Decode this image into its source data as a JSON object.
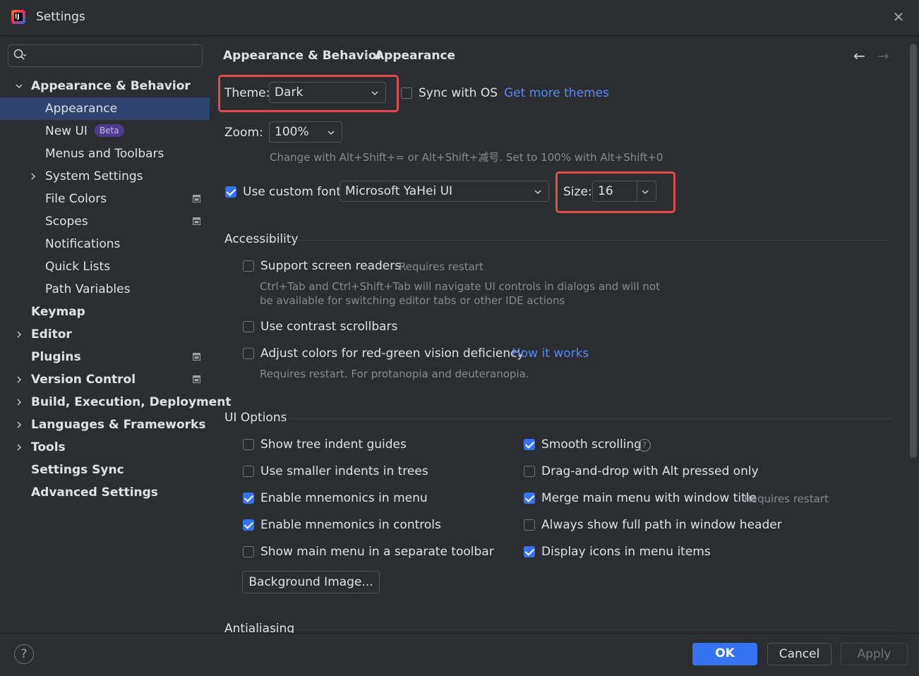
{
  "window": {
    "title": "Settings",
    "close_symbol": "✕",
    "app_icon_letters": "IJ"
  },
  "breadcrumb": {
    "parent": "Appearance & Behavior",
    "separator": "›",
    "current": "Appearance"
  },
  "nav": {
    "back_symbol": "←",
    "forward_symbol": "→"
  },
  "sidebar": {
    "search_placeholder": "",
    "items": [
      {
        "label": "Appearance & Behavior",
        "level": 0,
        "bold": true,
        "expandable": true,
        "expanded": true
      },
      {
        "label": "Appearance",
        "level": 1,
        "selected": true
      },
      {
        "label": "New UI",
        "level": 1,
        "badge": "Beta"
      },
      {
        "label": "Menus and Toolbars",
        "level": 1
      },
      {
        "label": "System Settings",
        "level": 1,
        "expandable": true,
        "expanded": false
      },
      {
        "label": "File Colors",
        "level": 1,
        "project_icon": true
      },
      {
        "label": "Scopes",
        "level": 1,
        "project_icon": true
      },
      {
        "label": "Notifications",
        "level": 1
      },
      {
        "label": "Quick Lists",
        "level": 1
      },
      {
        "label": "Path Variables",
        "level": 1
      },
      {
        "label": "Keymap",
        "level": 0,
        "bold": true
      },
      {
        "label": "Editor",
        "level": 0,
        "bold": true,
        "expandable": true,
        "expanded": false
      },
      {
        "label": "Plugins",
        "level": 0,
        "bold": true,
        "project_icon": true
      },
      {
        "label": "Version Control",
        "level": 0,
        "bold": true,
        "expandable": true,
        "expanded": false,
        "project_icon": true
      },
      {
        "label": "Build, Execution, Deployment",
        "level": 0,
        "bold": true,
        "expandable": true,
        "expanded": false
      },
      {
        "label": "Languages & Frameworks",
        "level": 0,
        "bold": true,
        "expandable": true,
        "expanded": false
      },
      {
        "label": "Tools",
        "level": 0,
        "bold": true,
        "expandable": true,
        "expanded": false
      },
      {
        "label": "Settings Sync",
        "level": 0,
        "bold": true
      },
      {
        "label": "Advanced Settings",
        "level": 0,
        "bold": true
      }
    ]
  },
  "theme": {
    "label": "Theme:",
    "value": "Dark",
    "sync_label": "Sync with OS",
    "sync_checked": false,
    "more_link": "Get more themes"
  },
  "zoom": {
    "label": "Zoom:",
    "value": "100%",
    "hint": "Change with Alt+Shift+= or Alt+Shift+减号. Set to 100% with Alt+Shift+0"
  },
  "font": {
    "use_custom_label": "Use custom font:",
    "use_custom_checked": true,
    "value": "Microsoft YaHei UI",
    "size_label": "Size:",
    "size_value": "16"
  },
  "accessibility": {
    "title": "Accessibility",
    "screen_readers_label": "Support screen readers",
    "screen_readers_checked": false,
    "screen_readers_hint": "Requires restart",
    "screen_readers_desc_1": "Ctrl+Tab and Ctrl+Shift+Tab will navigate UI controls in dialogs and will not",
    "screen_readers_desc_2": "be available for switching editor tabs or other IDE actions",
    "contrast_label": "Use contrast scrollbars",
    "contrast_checked": false,
    "red_green_label": "Adjust colors for red-green vision deficiency",
    "red_green_checked": false,
    "red_green_link": "How it works",
    "red_green_hint": "Requires restart. For protanopia and deuteranopia."
  },
  "ui_options": {
    "title": "UI Options",
    "left": [
      {
        "label": "Show tree indent guides",
        "checked": false
      },
      {
        "label": "Use smaller indents in trees",
        "checked": false
      },
      {
        "label": "Enable mnemonics in menu",
        "checked": true
      },
      {
        "label": "Enable mnemonics in controls",
        "checked": true
      },
      {
        "label": "Show main menu in a separate toolbar",
        "checked": false
      }
    ],
    "right": [
      {
        "label": "Smooth scrolling",
        "checked": true,
        "help": "?"
      },
      {
        "label": "Drag-and-drop with Alt pressed only",
        "checked": false
      },
      {
        "label": "Merge main menu with window title",
        "checked": true,
        "hint": "Requires restart"
      },
      {
        "label": "Always show full path in window header",
        "checked": false
      },
      {
        "label": "Display icons in menu items",
        "checked": true
      }
    ],
    "background_button": "Background Image..."
  },
  "antialiasing": {
    "title": "Antialiasing"
  },
  "footer": {
    "help": "?",
    "ok": "OK",
    "cancel": "Cancel",
    "apply": "Apply"
  },
  "colors": {
    "accent": "#3574f0",
    "selection": "#2e436e",
    "highlight_box": "#e5484d",
    "link": "#548af7",
    "background": "#2b2d30"
  }
}
